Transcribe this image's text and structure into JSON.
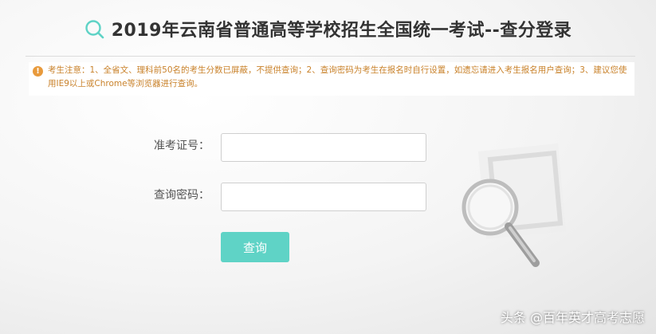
{
  "header": {
    "logo_icon": "search-icon",
    "title": "2019年云南省普通高等学校招生全国统一考试--查分登录"
  },
  "notice": {
    "icon": "warning-icon",
    "text": "考生注意：1、全省文、理科前50名的考生分数已屏蔽，不提供查询；2、查询密码为考生在报名时自行设置，如遗忘请进入考生报名用户查询；3、建议您使用IE9以上或Chrome等浏览器进行查询。"
  },
  "form": {
    "exam_id_label": "准考证号：",
    "exam_id_value": "",
    "password_label": "查询密码：",
    "password_value": "",
    "submit_label": "查询"
  },
  "decoration": {
    "icon": "magnifier-icon"
  },
  "watermark": "头条 @百年英才高考志愿",
  "colors": {
    "accent": "#5fd3c6",
    "notice_text": "#c9822b",
    "warning": "#e89a3c"
  }
}
